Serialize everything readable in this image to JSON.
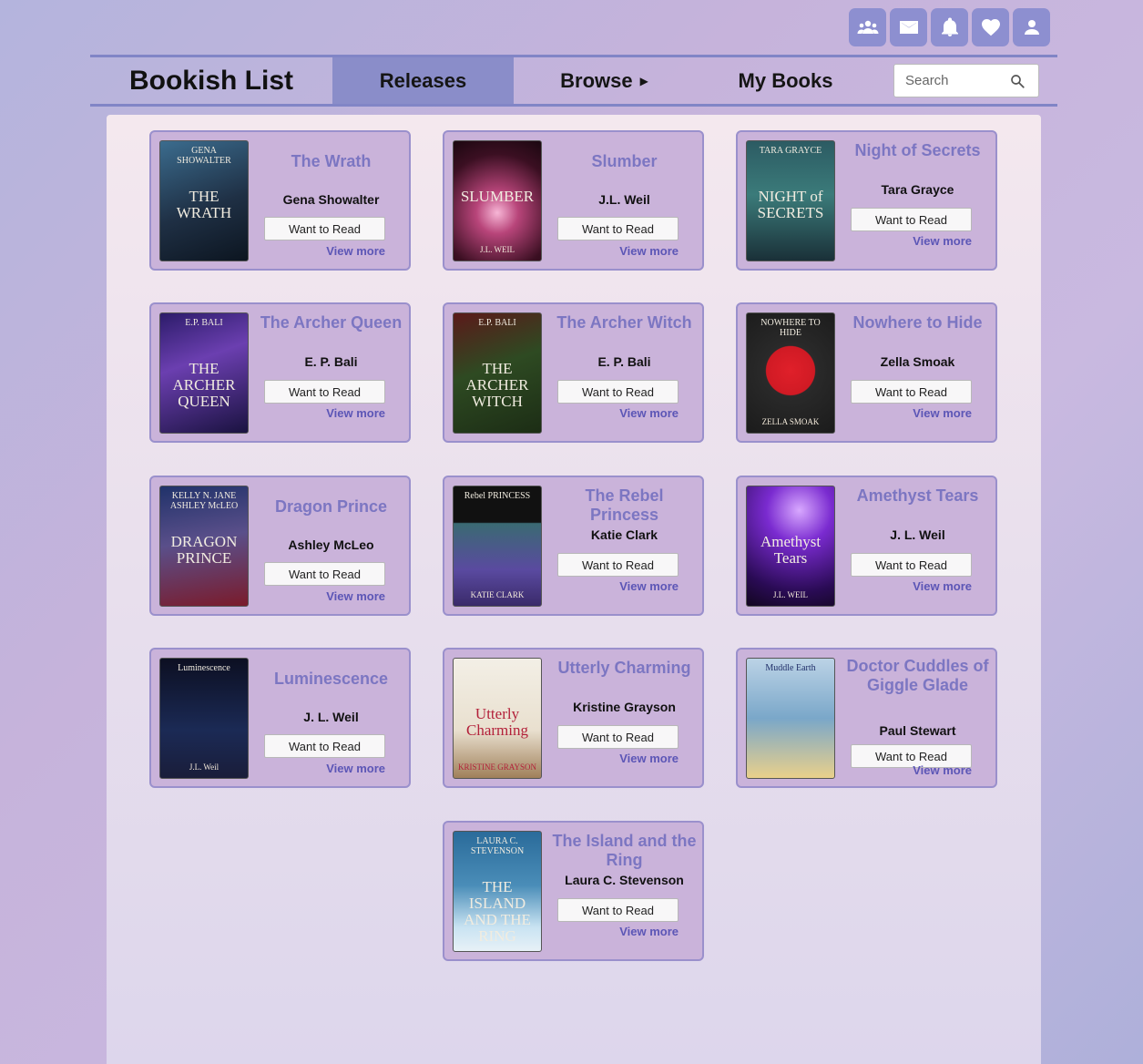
{
  "header": {
    "icons": [
      "groups-icon",
      "mail-icon",
      "bell-icon",
      "heart-icon",
      "person-icon"
    ]
  },
  "nav": {
    "brand": "Bookish List",
    "tabs": [
      {
        "label": "Releases",
        "active": true
      },
      {
        "label": "Browse",
        "active": false
      },
      {
        "label": "My Books",
        "active": false
      }
    ],
    "search_placeholder": "Search"
  },
  "colors": {
    "accent": "#8a8dc9",
    "card_bg": "#cab3da",
    "title": "#7c76c2",
    "link": "#5c56b6"
  },
  "books": [
    {
      "title": "The Wrath",
      "author": "Gena Showalter",
      "button": "Want to Read",
      "link": "View more",
      "cover": {
        "top": "GENA SHOWALTER",
        "title": "THE WRATH",
        "bottom": "",
        "bg": "linear-gradient(160deg,#3b6c8e,#1f3045 55%,#0c1520)"
      }
    },
    {
      "title": "Slumber",
      "author": "J.L. Weil",
      "button": "Want to Read",
      "link": "View more",
      "cover": {
        "top": "",
        "title": "SLUMBER",
        "bottom": "J.L. WEIL",
        "bg": "radial-gradient(circle at 50% 60%,#f7b6d6 0%,#b8457a 25%,#3b0f22 70%,#1b0710 100%)"
      }
    },
    {
      "title": "Night of Secrets",
      "author": "Tara Grayce",
      "button": "Want to Read",
      "link": "View more",
      "cover": {
        "top": "TARA GRAYCE",
        "title": "NIGHT of SECRETS",
        "bottom": "",
        "bg": "linear-gradient(180deg,#2c5b63,#3b7b7a 45%,#1a3038)"
      }
    },
    {
      "title": "The Archer Queen",
      "author": "E. P. Bali",
      "button": "Want to Read",
      "link": "View more",
      "cover": {
        "top": "E.P. BALI",
        "title": "THE ARCHER QUEEN",
        "bottom": "",
        "bg": "linear-gradient(160deg,#2c1c6a,#6b3fb0 40%,#1a1240)"
      }
    },
    {
      "title": "The Archer Witch",
      "author": "E. P. Bali",
      "button": "Want to Read",
      "link": "View more",
      "cover": {
        "top": "E.P. BALI",
        "title": "THE ARCHER WITCH",
        "bottom": "",
        "bg": "linear-gradient(160deg,#5b1a1a,#2e4a22 45%,#1c2d15)"
      }
    },
    {
      "title": "Nowhere to Hide",
      "author": "Zella Smoak",
      "button": "Want to Read",
      "link": "View more",
      "cover": {
        "top": "NOWHERE TO HIDE",
        "title": "",
        "bottom": "ZELLA SMOAK",
        "bg": "radial-gradient(circle at 50% 48%,#e0202a 0%,#d01a24 32%,#2a2a2a 33%,#1b1b1b 100%)"
      }
    },
    {
      "title": "Dragon Prince",
      "author": "Ashley McLeo",
      "button": "Want to Read",
      "link": "View more",
      "cover": {
        "top": "KELLY N. JANE ASHLEY McLEO",
        "title": "DRAGON PRINCE",
        "bottom": "",
        "bg": "linear-gradient(170deg,#20326a,#5a4f8a 45%,#7a1b2b)"
      }
    },
    {
      "title": "The Rebel Princess",
      "author": "Katie Clark",
      "button": "Want to Read",
      "link": "View more",
      "cover": {
        "top": "Rebel PRINCESS",
        "title": "",
        "bottom": "KATIE CLARK",
        "bg": "linear-gradient(180deg,#111 0%,#111 30%,#3a6a72 31%,#5a4aa0 70%,#3a2a6a)"
      }
    },
    {
      "title": "Amethyst Tears",
      "author": "J. L. Weil",
      "button": "Want to Read",
      "link": "View more",
      "cover": {
        "top": "",
        "title": "Amethyst Tears",
        "bottom": "J.L. WEIL",
        "bg": "radial-gradient(circle at 60% 20%,#d8a8ff 0%,#7a2bd0 30%,#2a0b55 75%,#12061f)"
      }
    },
    {
      "title": "Luminescence",
      "author": "J. L. Weil",
      "button": "Want to Read",
      "link": "View more",
      "cover": {
        "top": "Luminescence",
        "title": "",
        "bottom": "J.L. Weil",
        "bg": "linear-gradient(180deg,#0c0f22,#1b2a55 60%,#1a1d3a)"
      }
    },
    {
      "title": "Utterly Charming",
      "author": "Kristine Grayson",
      "button": "Want to Read",
      "link": "View more",
      "cover": {
        "top": "",
        "title": "Utterly Charming",
        "bottom": "KRISTINE GRAYSON",
        "bg": "linear-gradient(180deg,#f3efe6,#e9e0cf 60%,#a0805a)"
      }
    },
    {
      "title": "Doctor Cuddles of Giggle Glade",
      "author": "Paul Stewart",
      "button": "Want to Read",
      "link": "View more",
      "cover": {
        "top": "Muddle Earth",
        "title": "",
        "bottom": "",
        "bg": "linear-gradient(180deg,#bcd3e6,#7aa7c9 50%,#e9d08b)"
      }
    },
    {
      "title": "The Island and the Ring",
      "author": "Laura C. Stevenson",
      "button": "Want to Read",
      "link": "View more",
      "cover": {
        "top": "LAURA C. STEVENSON",
        "title": "THE ISLAND AND THE RING",
        "bottom": "",
        "bg": "linear-gradient(180deg,#2a6b9a,#4a8db8 45%,#c9e3f2 80%,#e7f1f7)"
      }
    }
  ]
}
